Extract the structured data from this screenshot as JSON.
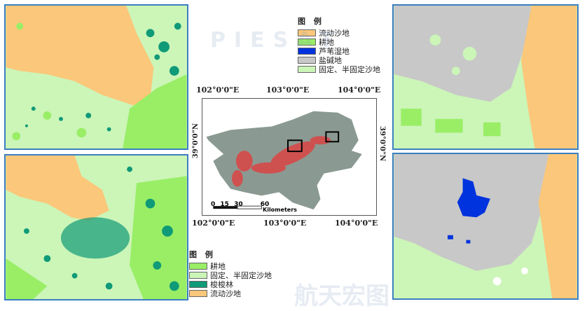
{
  "watermark": "航天宏图 PIESAT",
  "legend_top_right": {
    "title": "图 例",
    "items": [
      {
        "label": "流动沙地",
        "color": "#fbc77a"
      },
      {
        "label": "耕地",
        "color": "#99ee66"
      },
      {
        "label": "芦苇湿地",
        "color": "#0033dd"
      },
      {
        "label": "盐碱地",
        "color": "#c8c8c8"
      },
      {
        "label": "固定、半固定沙地",
        "color": "#ccf5b8"
      }
    ]
  },
  "legend_bottom_left": {
    "title": "图 例",
    "items": [
      {
        "label": "耕地",
        "color": "#99ee66"
      },
      {
        "label": "固定、半固定沙地",
        "color": "#ccf5b8"
      },
      {
        "label": "梭梭林",
        "color": "#0f9a78"
      },
      {
        "label": "流动沙地",
        "color": "#fbc77a"
      }
    ]
  },
  "map": {
    "top_ticks": [
      "102°0'0\"E",
      "103°0'0\"E",
      "104°0'0\"E"
    ],
    "bottom_ticks": [
      "102°0'0\"E",
      "103°0'0\"E",
      "104°0'0\"E"
    ],
    "left_tick": "39°0'0\"N",
    "right_tick": "39°0'0\"N",
    "scale_labels": [
      "0",
      "15",
      "30",
      "60"
    ],
    "scale_unit": "Kilometers"
  }
}
